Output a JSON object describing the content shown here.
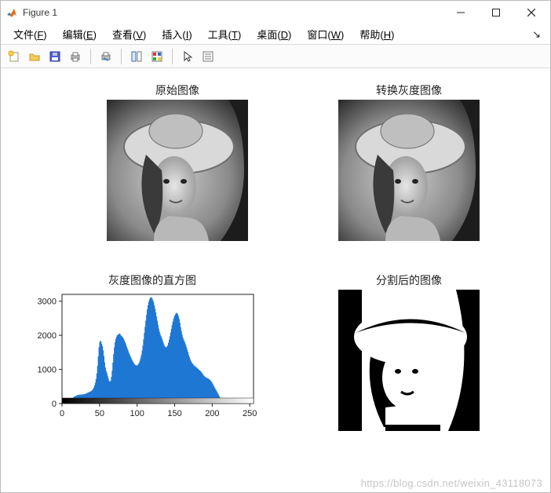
{
  "window": {
    "title": "Figure 1"
  },
  "menu": {
    "file": {
      "label": "文件(",
      "mnemonic": "F",
      "close": ")"
    },
    "edit": {
      "label": "编辑(",
      "mnemonic": "E",
      "close": ")"
    },
    "view": {
      "label": "查看(",
      "mnemonic": "V",
      "close": ")"
    },
    "insert": {
      "label": "插入(",
      "mnemonic": "I",
      "close": ")"
    },
    "tools": {
      "label": "工具(",
      "mnemonic": "T",
      "close": ")"
    },
    "desktop": {
      "label": "桌面(",
      "mnemonic": "D",
      "close": ")"
    },
    "window_": {
      "label": "窗口(",
      "mnemonic": "W",
      "close": ")"
    },
    "help": {
      "label": "帮助(",
      "mnemonic": "H",
      "close": ")"
    }
  },
  "toolbar_icons": {
    "new": "new-figure-icon",
    "open": "open-icon",
    "save": "save-icon",
    "print": "print-icon",
    "print_preview": "print-preview-icon",
    "datacursor": "data-cursor-icon",
    "colorbar": "colorbar-icon",
    "pointer": "pointer-icon",
    "insert": "legend-icon"
  },
  "subplots": {
    "tl": {
      "title": "原始图像"
    },
    "tr": {
      "title": "转换灰度图像"
    },
    "bl": {
      "title": "灰度图像的直方图"
    },
    "br": {
      "title": "分割后的图像"
    }
  },
  "chart_data": {
    "type": "bar",
    "title": "灰度图像的直方图",
    "xlabel": "",
    "ylabel": "",
    "xlim": [
      0,
      255
    ],
    "ylim": [
      0,
      3200
    ],
    "xticks": [
      0,
      50,
      100,
      150,
      200,
      250
    ],
    "yticks": [
      0,
      1000,
      2000,
      3000
    ],
    "categories_step": 1,
    "values": [
      0,
      0,
      0,
      0,
      10,
      20,
      30,
      40,
      50,
      60,
      80,
      100,
      120,
      140,
      160,
      180,
      200,
      210,
      220,
      230,
      240,
      250,
      255,
      258,
      260,
      262,
      264,
      266,
      268,
      270,
      275,
      280,
      290,
      300,
      310,
      320,
      330,
      340,
      350,
      360,
      380,
      400,
      430,
      470,
      530,
      610,
      720,
      880,
      1100,
      1380,
      1650,
      1800,
      1850,
      1820,
      1750,
      1680,
      1560,
      1390,
      1210,
      1060,
      960,
      900,
      820,
      740,
      670,
      640,
      670,
      780,
      960,
      1200,
      1450,
      1650,
      1800,
      1900,
      1960,
      2000,
      2020,
      2040,
      2050,
      2040,
      2010,
      1980,
      1960,
      1930,
      1900,
      1850,
      1800,
      1740,
      1680,
      1620,
      1560,
      1500,
      1450,
      1400,
      1350,
      1300,
      1260,
      1220,
      1180,
      1150,
      1130,
      1120,
      1120,
      1130,
      1160,
      1200,
      1260,
      1340,
      1430,
      1550,
      1700,
      1880,
      2070,
      2250,
      2430,
      2600,
      2760,
      2880,
      2980,
      3050,
      3100,
      3120,
      3110,
      3080,
      3030,
      2970,
      2880,
      2780,
      2670,
      2550,
      2430,
      2310,
      2200,
      2110,
      2040,
      1980,
      1930,
      1870,
      1800,
      1740,
      1690,
      1660,
      1650,
      1670,
      1710,
      1780,
      1870,
      1970,
      2080,
      2190,
      2300,
      2400,
      2480,
      2550,
      2600,
      2640,
      2660,
      2650,
      2620,
      2560,
      2480,
      2370,
      2240,
      2120,
      2020,
      1940,
      1880,
      1830,
      1780,
      1720,
      1650,
      1580,
      1510,
      1430,
      1360,
      1300,
      1250,
      1210,
      1180,
      1150,
      1120,
      1100,
      1090,
      1070,
      1050,
      1030,
      1010,
      990,
      970,
      950,
      930,
      900,
      870,
      840,
      810,
      790,
      770,
      760,
      750,
      740,
      730,
      710,
      690,
      670,
      640,
      610,
      570,
      530,
      490,
      450,
      410,
      370,
      330,
      290,
      250,
      210,
      170,
      140,
      112,
      90,
      72,
      58,
      46,
      36,
      28,
      22,
      17,
      13,
      10,
      8,
      6,
      5,
      4,
      3,
      2,
      2,
      1,
      1,
      1,
      1,
      0,
      0,
      0,
      0,
      0,
      0,
      0,
      0,
      0,
      0,
      0,
      0,
      0,
      0,
      0,
      0,
      0,
      0,
      0,
      0,
      0,
      0
    ]
  },
  "watermark": "https://blog.csdn.net/weixin_43118073"
}
